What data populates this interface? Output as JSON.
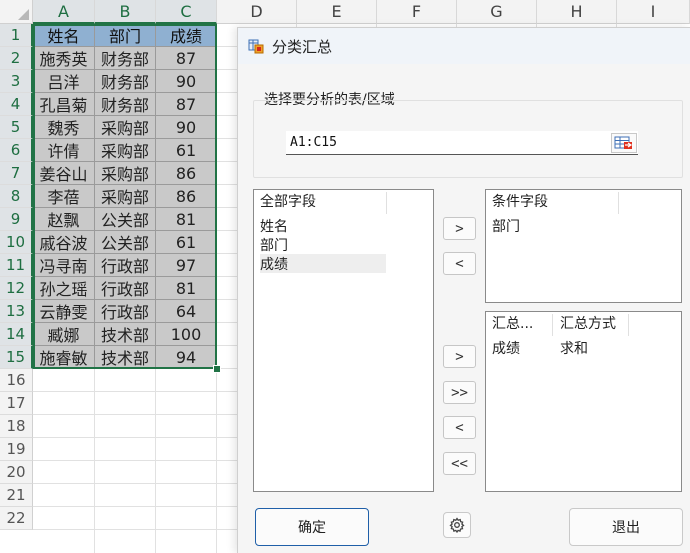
{
  "sheet": {
    "columns": [
      "A",
      "B",
      "C",
      "D",
      "E",
      "F",
      "G",
      "H",
      "I"
    ],
    "rows": [
      "1",
      "2",
      "3",
      "4",
      "5",
      "6",
      "7",
      "8",
      "9",
      "10",
      "11",
      "12",
      "13",
      "14",
      "15",
      "16",
      "17",
      "18",
      "19",
      "20",
      "21",
      "22"
    ],
    "header": [
      "姓名",
      "部门",
      "成绩"
    ],
    "data": [
      [
        "施秀英",
        "财务部",
        "87"
      ],
      [
        "吕洋",
        "财务部",
        "90"
      ],
      [
        "孔昌菊",
        "财务部",
        "87"
      ],
      [
        "魏秀",
        "采购部",
        "90"
      ],
      [
        "许倩",
        "采购部",
        "61"
      ],
      [
        "姜谷山",
        "采购部",
        "86"
      ],
      [
        "李蓓",
        "采购部",
        "86"
      ],
      [
        "赵飘",
        "公关部",
        "81"
      ],
      [
        "戚谷波",
        "公关部",
        "61"
      ],
      [
        "冯寻南",
        "行政部",
        "97"
      ],
      [
        "孙之瑶",
        "行政部",
        "81"
      ],
      [
        "云静雯",
        "行政部",
        "64"
      ],
      [
        "臧娜",
        "技术部",
        "100"
      ],
      [
        "施睿敏",
        "技术部",
        "94"
      ]
    ]
  },
  "dialog": {
    "title": "分类汇总",
    "range_group_label": "选择要分析的表/区域",
    "range_value": "A1:C15",
    "all_fields": {
      "header": "全部字段",
      "items": [
        "姓名",
        "部门",
        "成绩"
      ]
    },
    "condition_fields": {
      "header": "条件字段",
      "items": [
        "部门"
      ]
    },
    "summary_fields": {
      "col1_header": "汇总...",
      "col2_header": "汇总方式",
      "rows": [
        [
          "成绩",
          "求和"
        ]
      ]
    },
    "buttons": {
      "add_condition": ">",
      "remove_condition": "<",
      "add_summary": ">",
      "add_all_summary": ">>",
      "remove_summary": "<",
      "remove_all_summary": "<<",
      "ok": "确定",
      "exit": "退出"
    }
  },
  "colors": {
    "header_fill": "#8fb0d1",
    "data_fill": "#c9c9c9",
    "selection_border": "#217346",
    "primary_border": "#1f5fa8"
  }
}
